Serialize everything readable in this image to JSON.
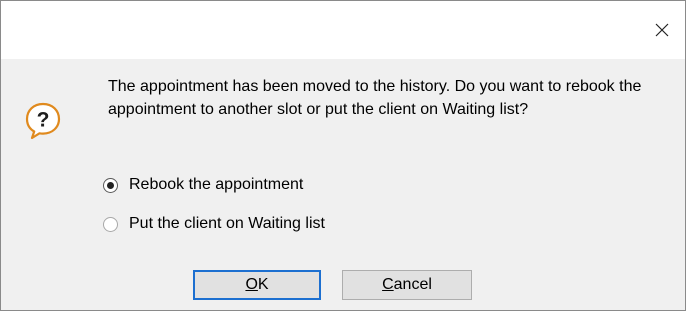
{
  "dialog": {
    "message": "The appointment has been moved to the history. Do you want to rebook the appointment to another slot or put the client on Waiting list?",
    "icon": "question-icon",
    "close_icon": "close-icon"
  },
  "options": [
    {
      "label": "Rebook the appointment",
      "checked": true
    },
    {
      "label": "Put the client on Waiting list",
      "checked": false
    }
  ],
  "buttons": {
    "ok": {
      "mnemonic": "O",
      "rest": "K"
    },
    "cancel": {
      "mnemonic": "C",
      "rest": "ancel"
    }
  },
  "colors": {
    "accent": "#1c6fd0",
    "icon": "#e08a1e"
  }
}
